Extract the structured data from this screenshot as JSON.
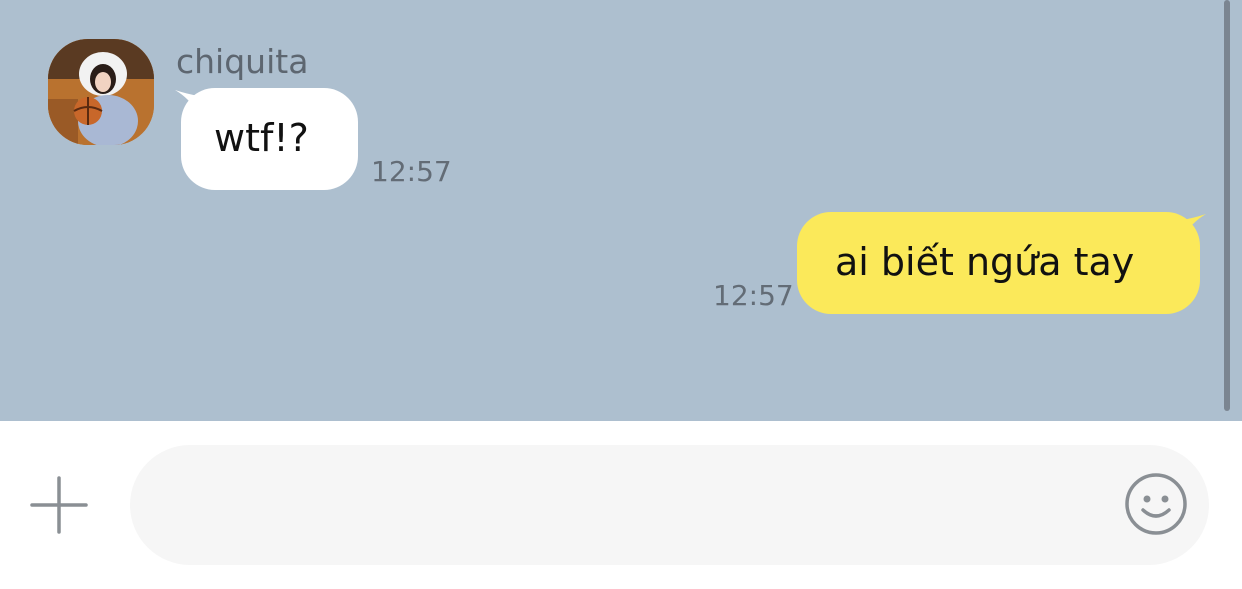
{
  "conversation": {
    "messages": [
      {
        "direction": "incoming",
        "sender": "chiquita",
        "text": "wtf!?",
        "time": "12:57"
      },
      {
        "direction": "outgoing",
        "text": "ai biết ngứa tay",
        "time": "12:57"
      }
    ]
  },
  "composer": {
    "placeholder": "",
    "value": "",
    "plus_icon": "plus-icon",
    "emoji_icon": "smiley-icon"
  },
  "colors": {
    "chat_background": "#adbfcf",
    "incoming_bubble": "#ffffff",
    "outgoing_bubble": "#fbe95a",
    "input_background": "#f6f6f6"
  }
}
